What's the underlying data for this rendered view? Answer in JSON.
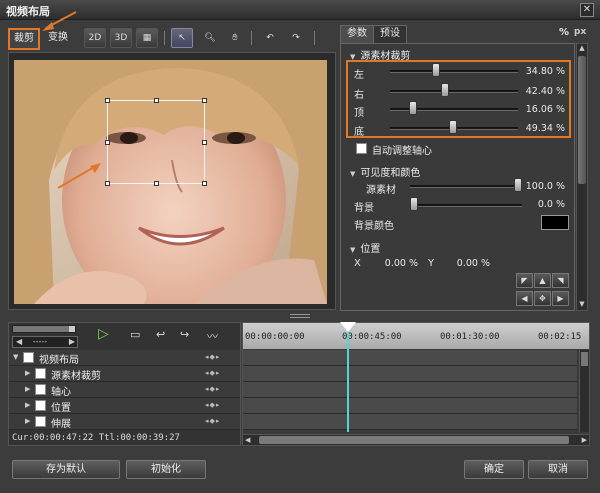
{
  "window": {
    "title": "视频布局",
    "close_glyph": "✕"
  },
  "left_tabs": {
    "crop": "裁剪",
    "transform": "变换"
  },
  "toolbar": [
    "2D-mode",
    "3D-mode",
    "grid",
    "select",
    "zoom",
    "hand",
    "undo",
    "redo"
  ],
  "right_tabs": {
    "params": "参数",
    "preset": "预设"
  },
  "units": {
    "percent": "%",
    "pixel": "px"
  },
  "crop_section": {
    "title": "源素材裁剪",
    "rows": [
      {
        "label": "左",
        "value": "34.80 %",
        "level": 0.348
      },
      {
        "label": "右",
        "value": "42.40 %",
        "level": 0.424
      },
      {
        "label": "顶",
        "value": "16.06 %",
        "level": 0.1606
      },
      {
        "label": "底",
        "value": "49.34 %",
        "level": 0.4934
      }
    ],
    "auto_axis": "自动调整轴心"
  },
  "visibility_section": {
    "title": "可见度和颜色",
    "source_label": "源素材",
    "source_value": "100.0 %",
    "source_level": 1.0,
    "bg_label": "背景",
    "bg_value": "0.0 %",
    "bg_level": 0.0,
    "bgcolor_label": "背景颜色",
    "bgcolor": "#000000"
  },
  "position_section": {
    "title": "位置",
    "x_label": "X",
    "x_value": "0.00 %",
    "y_label": "Y",
    "y_value": "0.00 %"
  },
  "timeline": {
    "timecodes": [
      "00:00:00:00",
      "00:00:45:00",
      "00:01:30:00",
      "00:02:15"
    ],
    "playhead_fraction": 0.3,
    "tracks": [
      {
        "label": "视频布局",
        "level": 0
      },
      {
        "label": "源素材裁剪",
        "level": 1
      },
      {
        "label": "轴心",
        "level": 1
      },
      {
        "label": "位置",
        "level": 1
      },
      {
        "label": "伸展",
        "level": 1
      }
    ],
    "status": "Cur:00:00:47:22 Ttl:00:00:39:27",
    "dropdown": "-----"
  },
  "buttons": {
    "save_default": "存为默认",
    "init": "初始化",
    "ok": "确定",
    "cancel": "取消"
  },
  "colors": {
    "highlight": "#e07828",
    "playhead": "#4fd6d6"
  }
}
